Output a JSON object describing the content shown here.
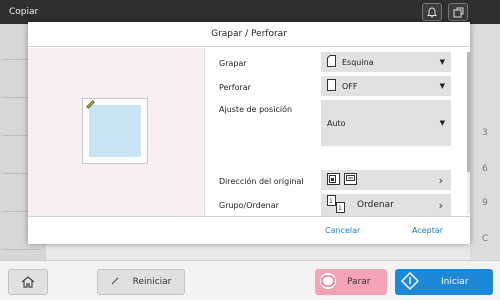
{
  "header": {
    "title": "Copiar"
  },
  "dialog": {
    "title": "Grapar / Perforar",
    "rows": {
      "grapar": {
        "label": "Grapar",
        "value": "Esquina"
      },
      "perforar": {
        "label": "Perforar",
        "value": "OFF"
      },
      "ajuste": {
        "label": "Ajuste de posición",
        "value": "Auto"
      },
      "direccion": {
        "label": "Dirección del original"
      },
      "grupo": {
        "label": "Grupo/Ordenar",
        "value": "Ordenar"
      }
    },
    "cancel": "Cancelar",
    "accept": "Aceptar"
  },
  "background": {
    "right_numbers": [
      "3",
      "6",
      "9",
      "C"
    ]
  },
  "bottom": {
    "reset": "Reiniciar",
    "stop": "Parar",
    "start": "Iniciar"
  },
  "colors": {
    "start": "#1e88d8",
    "stop": "#f4a2b6",
    "link": "#1a7fc6",
    "preview_bg": "#f8eef4"
  }
}
